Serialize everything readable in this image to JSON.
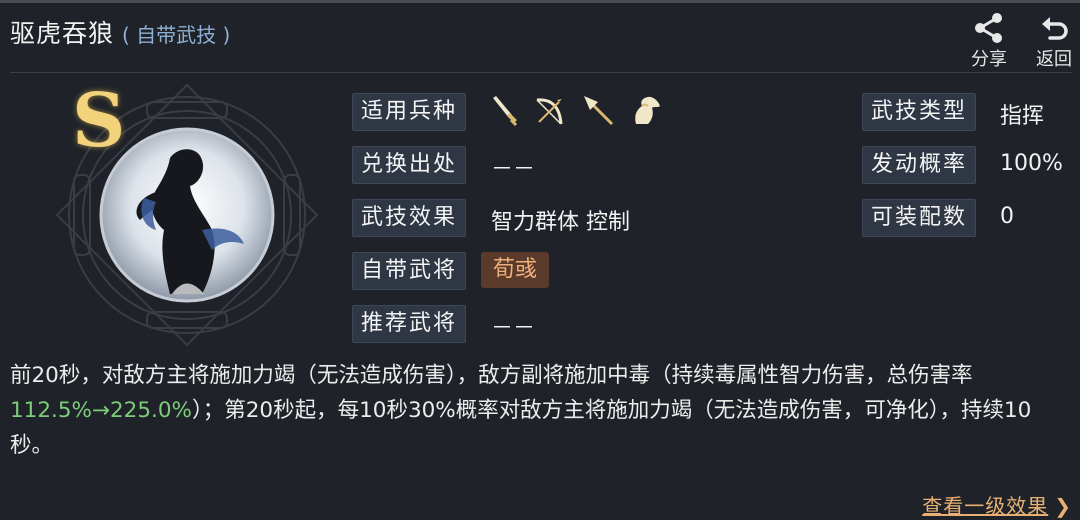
{
  "header": {
    "title": "驱虎吞狼",
    "subtitle": "( 自带武技 )",
    "share_label": "分享",
    "back_label": "返回"
  },
  "skill": {
    "grade": "S",
    "portrait": "ink-painting-figure-medallion"
  },
  "left_fields": [
    {
      "label": "适用兵种",
      "value": ""
    },
    {
      "label": "兑换出处",
      "value": "－－"
    },
    {
      "label": "武技效果",
      "value": "智力群体 控制"
    },
    {
      "label": "自带武将",
      "value": "荀彧"
    },
    {
      "label": "推荐武将",
      "value": "－－"
    }
  ],
  "troop_icons": [
    "sword-icon",
    "bow-icon",
    "spear-icon",
    "horse-icon"
  ],
  "right_fields": [
    {
      "label": "武技类型",
      "value": "指挥"
    },
    {
      "label": "发动概率",
      "value": "100%"
    },
    {
      "label": "可装配数",
      "value": "0"
    }
  ],
  "description": {
    "part1": "前20秒，对敌方主将施加力竭（无法造成伤害），敌方副将施加中毒（持续毒属性智力伤害，总伤害率",
    "highlight": "112.5%→225.0%",
    "part2": "）；第20秒起，每10秒30%概率对敌方主将施加力竭（无法造成伤害，可净化），持续10秒。"
  },
  "footer": {
    "link_label": "查看一级效果",
    "link_chevron": "❯"
  },
  "colors": {
    "background": "#1f2228",
    "label_chip": "#303744",
    "highlight_green": "#7ccc7a",
    "link_orange": "#e8b173",
    "grade_gold": "#f2d37b"
  }
}
